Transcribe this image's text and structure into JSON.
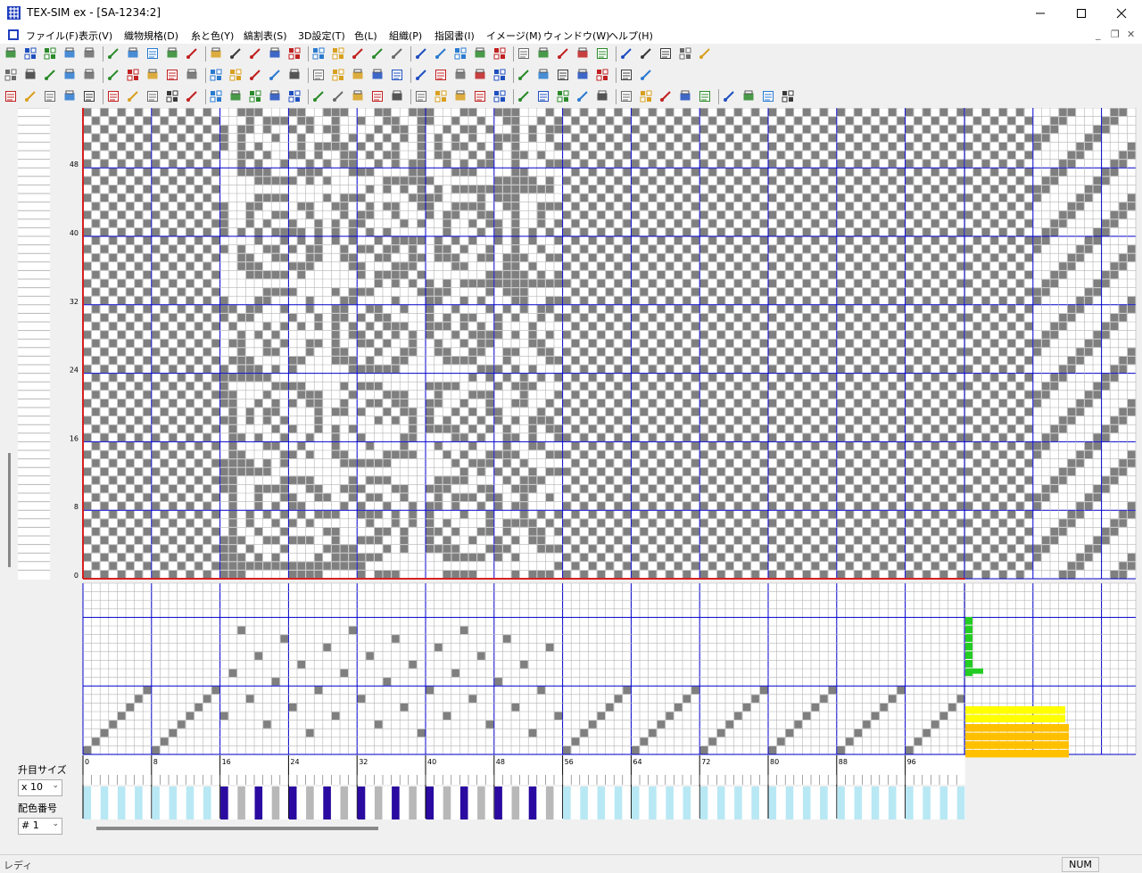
{
  "window": {
    "title": "TEX-SIM ex - [SA-1234:2]"
  },
  "menu": [
    {
      "id": "file",
      "label": "ファイル(F)"
    },
    {
      "id": "view",
      "label": "表示(V)"
    },
    {
      "id": "fabric-spec",
      "label": "織物規格(D)"
    },
    {
      "id": "yarn-color",
      "label": "糸と色(Y)"
    },
    {
      "id": "stripe",
      "label": "縞割表(S)"
    },
    {
      "id": "3d",
      "label": "3D設定(T)"
    },
    {
      "id": "color",
      "label": "色(L)"
    },
    {
      "id": "weave",
      "label": "組織(P)"
    },
    {
      "id": "draft",
      "label": "指図書(I)"
    },
    {
      "id": "image",
      "label": "イメージ(M)"
    },
    {
      "id": "window",
      "label": "ウィンドウ(W)"
    },
    {
      "id": "help",
      "label": "ヘルプ(H)"
    }
  ],
  "toolbars": {
    "row1": [
      "new",
      "open",
      "open-folder",
      "save",
      "save-as",
      "close-doc",
      "close-all",
      "select-region",
      "reverse",
      "print",
      "print-preview",
      "print-setup",
      "page-setup",
      "weave-grid",
      "weave-table",
      "weave-view",
      "warp-view",
      "weft-view",
      "stripe-table",
      "stripe-list",
      "warp-color",
      "color-palette",
      "dye",
      "yarn",
      "yarn-list",
      "texture",
      "texture-2",
      "pattern",
      "color-setup",
      "yarn-3d",
      "print-3d",
      "open-3d",
      "wand",
      "help",
      "exit"
    ],
    "row2": [
      "draft",
      "pencil",
      "line",
      "link",
      "checker",
      "checker-2",
      "library",
      "open-lib",
      "save-lib",
      "import",
      "print-draft",
      "zoom-small",
      "zoom-large",
      "pattern-a",
      "pattern-b",
      "pattern-c",
      "pattern-d",
      "flower",
      "threading",
      "weave-pattern",
      "align-left",
      "align-right",
      "align-top",
      "align-bottom",
      "sep-1",
      "sep-2",
      "sep-3",
      "sep-4",
      "zoom-in",
      "zoom-out",
      "zoom-reset",
      "grid-toggle"
    ],
    "row3": [
      "fill",
      "arrow",
      "select",
      "undo",
      "redo",
      "cut",
      "copy",
      "paste",
      "paste-special",
      "erase",
      "rotate-left",
      "rotate-right",
      "turn-left",
      "turn-right",
      "shift-h",
      "shift-v",
      "flip-h",
      "flip-v",
      "invert",
      "repeat-1",
      "repeat-2",
      "repeat-3",
      "tie-1",
      "tie-2",
      "tie-3",
      "tie-4",
      "cell-1",
      "cell-2",
      "cell-3",
      "cell-4",
      "cell-5",
      "cell-6",
      "cell-7",
      "cell-8",
      "cell-9",
      "cell-10",
      "cell-11",
      "cell-12",
      "cell-13"
    ]
  },
  "grid": {
    "row_labels": [
      "0",
      "8",
      "16",
      "24",
      "32",
      "40",
      "48"
    ],
    "col_labels": [
      "0",
      "8",
      "16",
      "24",
      "32",
      "40",
      "48",
      "56",
      "64",
      "72",
      "80",
      "88",
      "96"
    ]
  },
  "side": {
    "size_label": "升目サイズ",
    "size_value": "x 10",
    "color_label": "配色番号",
    "color_value": "# 1"
  },
  "colors": {
    "cell": "#7f7f7f",
    "grid": "#b4b4b4",
    "major": "#0000cc",
    "border_red": "#d82020",
    "stripe_light": "#b8e8f4",
    "stripe_dark": "#2a0aa0",
    "stripe_gray": "#b8b8b8",
    "bar_green": "#22cc22",
    "bar_yellow": "#ffff00",
    "bar_orange": "#ffc000"
  },
  "status": {
    "text": "レディ",
    "num": "NUM"
  }
}
